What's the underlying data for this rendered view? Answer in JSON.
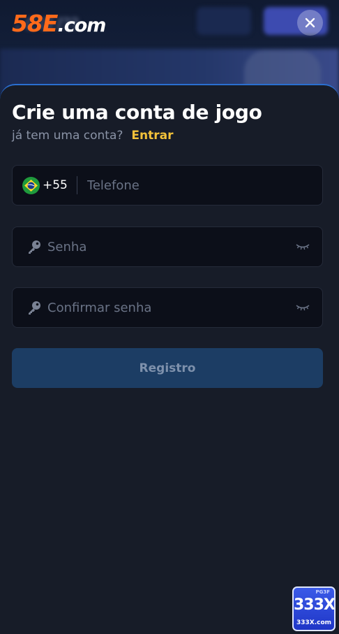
{
  "header": {
    "logo_main": "58E",
    "logo_sub": ".com",
    "close_icon": "close-icon"
  },
  "form": {
    "title": "Crie uma conta de jogo",
    "have_account_text": "já tem uma conta?",
    "login_link": "Entrar",
    "phone": {
      "flag_icon": "brazil-flag-icon",
      "country_code": "+55",
      "placeholder": "Telefone",
      "value": ""
    },
    "password": {
      "icon": "key-icon",
      "placeholder": "Senha",
      "value": "",
      "toggle_icon": "eye-closed-icon"
    },
    "confirm_password": {
      "icon": "key-icon",
      "placeholder": "Confirmar senha",
      "value": "",
      "toggle_icon": "eye-closed-icon"
    },
    "submit_label": "Registro"
  },
  "watermark": {
    "top": "PG3F",
    "main": "333X",
    "sub": "333X.com"
  },
  "colors": {
    "accent_link": "#f3c23a",
    "brand_orange": "#ff6a1a",
    "submit_bg": "#1c3d64",
    "sheet_bg": "#171c28",
    "sheet_border": "#2a6fd0"
  }
}
